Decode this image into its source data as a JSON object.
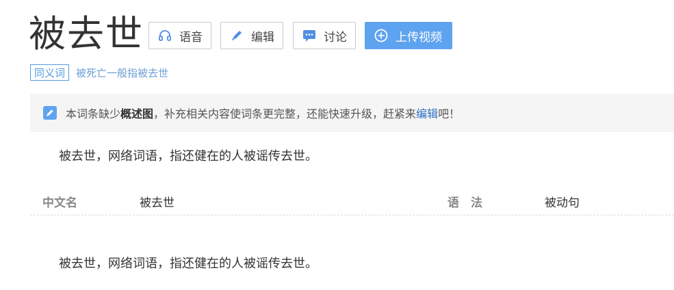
{
  "entry": {
    "title": "被去世",
    "actions": {
      "voice": "语音",
      "edit": "编辑",
      "discuss": "讨论",
      "upload_video": "上传视频"
    },
    "synonym": {
      "tag": "同义词",
      "text": "被死亡一般指被去世"
    }
  },
  "notice": {
    "prefix": "本词条缺少",
    "bold": "概述图",
    "middle": "，补充相关内容使词条更完整，还能快速升级，赶紧来",
    "link": "编辑",
    "suffix": "吧！"
  },
  "summary": "被去世，网络词语，指还健在的人被谣传去世。",
  "basic_info": {
    "k1": "中文名",
    "v1": "被去世",
    "k2": "语　法",
    "v2": "被动句"
  },
  "body_paragraph": "被去世，网络词语，指还健在的人被谣传去世。",
  "colors": {
    "accent": "#4f9be4",
    "upload_bg": "#5ea3f0",
    "link": "#2f6fc3"
  }
}
